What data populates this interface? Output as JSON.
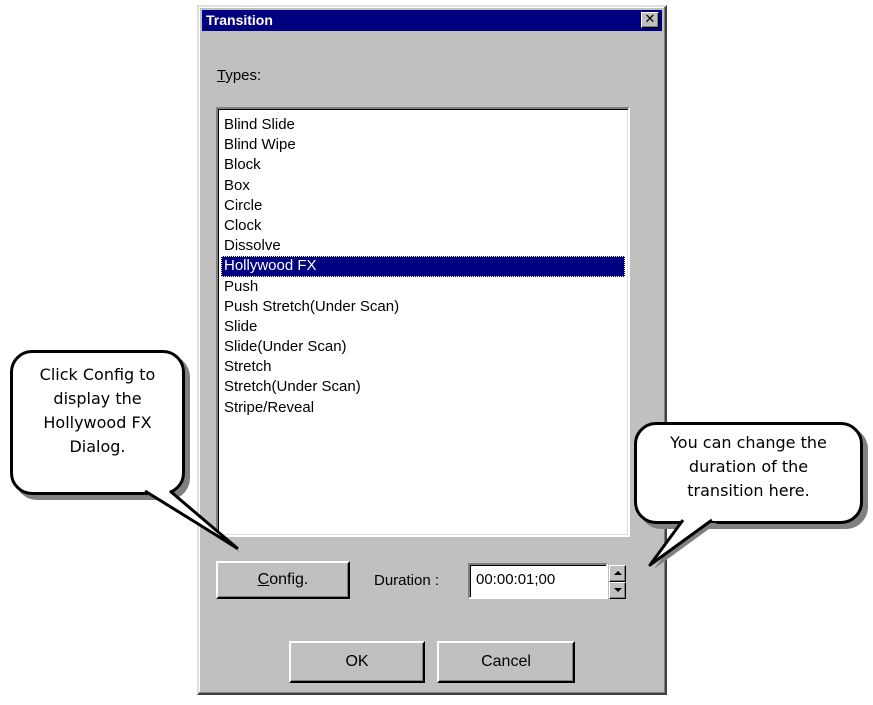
{
  "dialog": {
    "title": "Transition",
    "close_symbol": "✕",
    "types_label_accel": "T",
    "types_label_rest": "ypes:",
    "types_list": [
      "Blind Slide",
      "Blind Wipe",
      "Block",
      "Box",
      "Circle",
      "Clock",
      "Dissolve",
      "Hollywood FX",
      "Push",
      "Push Stretch(Under Scan)",
      "Slide",
      "Slide(Under Scan)",
      "Stretch",
      "Stretch(Under Scan)",
      "Stripe/Reveal"
    ],
    "selected_type": "Hollywood FX",
    "config_button_accel": "C",
    "config_button_rest": "onfig.",
    "duration_label": "Duration :",
    "duration_value": "00:00:01;00",
    "ok_button": "OK",
    "cancel_button": "Cancel"
  },
  "callouts": {
    "left": [
      "Click Config to",
      "display  the",
      "Hollywood FX",
      "Dialog."
    ],
    "right": [
      "You can change the",
      "duration of the",
      "transition here."
    ]
  },
  "colors": {
    "dialog_face": "#c0c0c0",
    "titlebar": "#000080",
    "selection": "#000080",
    "callout_shadow": "#808080"
  },
  "icons": {
    "close": "close-icon",
    "spin_up": "spin-up-arrow-icon",
    "spin_down": "spin-down-arrow-icon"
  }
}
